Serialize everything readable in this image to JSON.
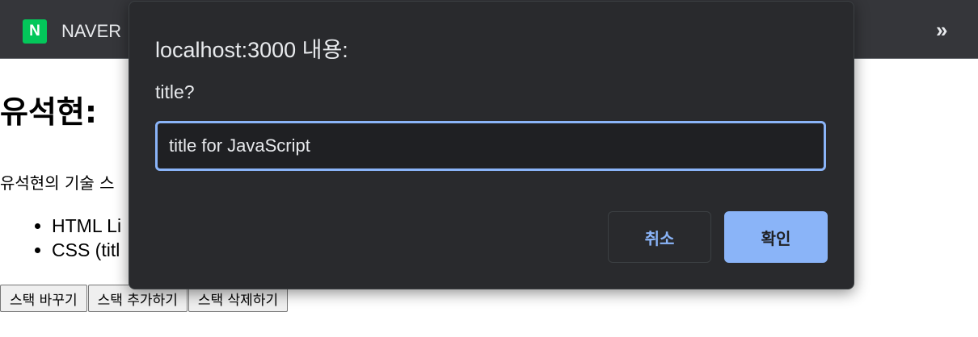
{
  "bookmarks_bar": {
    "items": [
      {
        "icon": "naver-icon",
        "icon_letter": "N",
        "label": "NAVER"
      }
    ],
    "overflow_label": "»",
    "bg_color": "#35363a"
  },
  "page": {
    "heading": "유석현:",
    "description": "유석현의 기술 스",
    "stack_items": [
      "HTML Li",
      "CSS (titl"
    ],
    "buttons": {
      "change_label": "스택 바꾸기",
      "add_label": "스택 추가하기",
      "delete_label": "스택 삭제하기"
    }
  },
  "dialog": {
    "title": "localhost:3000 내용:",
    "message": "title?",
    "input_value": "title for JavaScript",
    "cancel_label": "취소",
    "ok_label": "확인",
    "accent_color": "#8ab4f8",
    "bg_color": "#292a2d"
  }
}
